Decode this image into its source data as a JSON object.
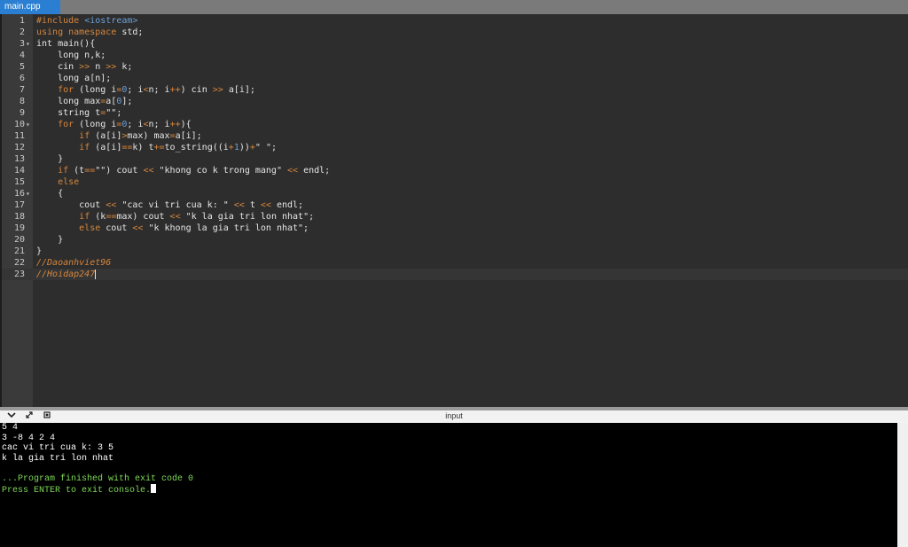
{
  "tab": {
    "label": "main.cpp"
  },
  "code_lines": [
    {
      "n": "1",
      "fold": "",
      "html": "<span class='pp'>#include</span> <span class='ang'>&lt;iostream&gt;</span>"
    },
    {
      "n": "2",
      "fold": "",
      "html": "<span class='kw'>using</span> <span class='kw'>namespace</span> std;"
    },
    {
      "n": "3",
      "fold": "▾",
      "html": "int main(){"
    },
    {
      "n": "4",
      "fold": "",
      "html": "    long n,k;"
    },
    {
      "n": "5",
      "fold": "",
      "html": "    cin <span class='op'>&gt;&gt;</span> n <span class='op'>&gt;&gt;</span> k;"
    },
    {
      "n": "6",
      "fold": "",
      "html": "    long a[n];"
    },
    {
      "n": "7",
      "fold": "",
      "html": "    <span class='kw'>for</span> (long i<span class='op'>=</span><span class='num'>0</span>; i<span class='op'>&lt;</span>n; i<span class='op'>++</span>) cin <span class='op'>&gt;&gt;</span> a[i];"
    },
    {
      "n": "8",
      "fold": "",
      "html": "    long max<span class='op'>=</span>a[<span class='num'>0</span>];"
    },
    {
      "n": "9",
      "fold": "",
      "html": "    string t<span class='op'>=</span>\"\";"
    },
    {
      "n": "10",
      "fold": "▾",
      "html": "    <span class='kw'>for</span> (long i<span class='op'>=</span><span class='num'>0</span>; i<span class='op'>&lt;</span>n; i<span class='op'>++</span>){"
    },
    {
      "n": "11",
      "fold": "",
      "html": "        <span class='kw'>if</span> (a[i]<span class='op'>&gt;</span>max) max<span class='op'>=</span>a[i];"
    },
    {
      "n": "12",
      "fold": "",
      "html": "        <span class='kw'>if</span> (a[i]<span class='op'>==</span>k) t<span class='op'>+=</span>to_string((i<span class='op'>+</span><span class='num'>1</span>))<span class='op'>+</span>\" \";"
    },
    {
      "n": "13",
      "fold": "",
      "html": "    }"
    },
    {
      "n": "14",
      "fold": "",
      "html": "    <span class='kw'>if</span> (t<span class='op'>==</span>\"\") cout <span class='op'>&lt;&lt;</span> \"khong co k trong mang\" <span class='op'>&lt;&lt;</span> endl;"
    },
    {
      "n": "15",
      "fold": "",
      "html": "    <span class='kw'>else</span>"
    },
    {
      "n": "16",
      "fold": "▾",
      "html": "    {"
    },
    {
      "n": "17",
      "fold": "",
      "html": "        cout <span class='op'>&lt;&lt;</span> \"cac vi tri cua k: \" <span class='op'>&lt;&lt;</span> t <span class='op'>&lt;&lt;</span> endl;"
    },
    {
      "n": "18",
      "fold": "",
      "html": "        <span class='kw'>if</span> (k<span class='op'>==</span>max) cout <span class='op'>&lt;&lt;</span> \"k la gia tri lon nhat\";"
    },
    {
      "n": "19",
      "fold": "",
      "html": "        <span class='kw'>else</span> cout <span class='op'>&lt;&lt;</span> \"k khong la gia tri lon nhat\";"
    },
    {
      "n": "20",
      "fold": "",
      "html": "    }"
    },
    {
      "n": "21",
      "fold": "",
      "html": "}"
    },
    {
      "n": "22",
      "fold": "",
      "html": "<span class='cm'>//Daoanhviet96</span>"
    },
    {
      "n": "23",
      "fold": "",
      "html": "<span class='cm'>//Hoidap247</span><span class='cursor'></span>"
    }
  ],
  "panel": {
    "title": "input",
    "collapse_icon": "chevron-down-icon",
    "expand_icon": "expand-icon",
    "settings_icon": "settings-icon"
  },
  "console": {
    "lines": [
      {
        "text": "5 4",
        "color": "white"
      },
      {
        "text": "3 -8 4 2 4",
        "color": "white"
      },
      {
        "text": "cac vi tri cua k: 3 5",
        "color": "white"
      },
      {
        "text": "k la gia tri lon nhat",
        "color": "white"
      },
      {
        "text": "",
        "color": "white"
      },
      {
        "text": "...Program finished with exit code 0",
        "color": "green"
      },
      {
        "text": "Press ENTER to exit console.",
        "color": "green"
      }
    ]
  }
}
